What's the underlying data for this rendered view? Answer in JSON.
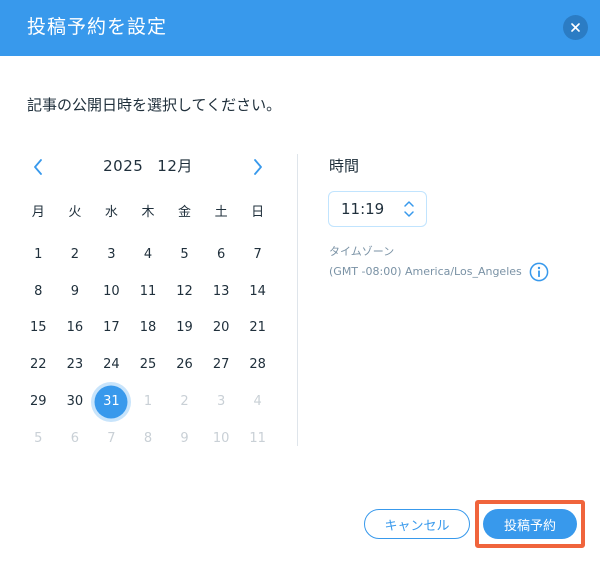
{
  "dialog": {
    "title": "投稿予約を設定",
    "close_icon": "close-icon",
    "instruction": "記事の公開日時を選択してください。"
  },
  "calendar": {
    "year": "2025",
    "month": "12月",
    "prev_icon": "chevron-left-icon",
    "next_icon": "chevron-right-icon",
    "weekdays": [
      "月",
      "火",
      "水",
      "木",
      "金",
      "土",
      "日"
    ],
    "weeks": [
      [
        {
          "d": "1",
          "m": "cur"
        },
        {
          "d": "2",
          "m": "cur"
        },
        {
          "d": "3",
          "m": "cur"
        },
        {
          "d": "4",
          "m": "cur"
        },
        {
          "d": "5",
          "m": "cur"
        },
        {
          "d": "6",
          "m": "cur"
        },
        {
          "d": "7",
          "m": "cur"
        }
      ],
      [
        {
          "d": "8",
          "m": "cur"
        },
        {
          "d": "9",
          "m": "cur"
        },
        {
          "d": "10",
          "m": "cur"
        },
        {
          "d": "11",
          "m": "cur"
        },
        {
          "d": "12",
          "m": "cur"
        },
        {
          "d": "13",
          "m": "cur"
        },
        {
          "d": "14",
          "m": "cur"
        }
      ],
      [
        {
          "d": "15",
          "m": "cur"
        },
        {
          "d": "16",
          "m": "cur"
        },
        {
          "d": "17",
          "m": "cur"
        },
        {
          "d": "18",
          "m": "cur"
        },
        {
          "d": "19",
          "m": "cur"
        },
        {
          "d": "20",
          "m": "cur"
        },
        {
          "d": "21",
          "m": "cur"
        }
      ],
      [
        {
          "d": "22",
          "m": "cur"
        },
        {
          "d": "23",
          "m": "cur"
        },
        {
          "d": "24",
          "m": "cur"
        },
        {
          "d": "25",
          "m": "cur"
        },
        {
          "d": "26",
          "m": "cur"
        },
        {
          "d": "27",
          "m": "cur"
        },
        {
          "d": "28",
          "m": "cur"
        }
      ],
      [
        {
          "d": "29",
          "m": "cur"
        },
        {
          "d": "30",
          "m": "cur"
        },
        {
          "d": "31",
          "m": "cur",
          "selected": true
        },
        {
          "d": "1",
          "m": "next"
        },
        {
          "d": "2",
          "m": "next"
        },
        {
          "d": "3",
          "m": "next"
        },
        {
          "d": "4",
          "m": "next"
        }
      ],
      [
        {
          "d": "5",
          "m": "next"
        },
        {
          "d": "6",
          "m": "next"
        },
        {
          "d": "7",
          "m": "next"
        },
        {
          "d": "8",
          "m": "next"
        },
        {
          "d": "9",
          "m": "next"
        },
        {
          "d": "10",
          "m": "next"
        },
        {
          "d": "11",
          "m": "next"
        }
      ]
    ]
  },
  "time": {
    "label": "時間",
    "value": "11:19",
    "stepper_icon": "up-down-chevron-icon"
  },
  "timezone": {
    "label": "タイムゾーン",
    "value": "(GMT -08:00) America/Los_Angeles",
    "info_icon": "info-icon"
  },
  "actions": {
    "cancel_label": "キャンセル",
    "schedule_label": "投稿予約"
  },
  "colors": {
    "primary": "#3899ec",
    "selected_ring": "#c8e4fb",
    "highlight_outline": "#f0643c",
    "text": "#20303c",
    "muted_text": "#7a92a5",
    "disabled_day": "#c9d0d6"
  }
}
